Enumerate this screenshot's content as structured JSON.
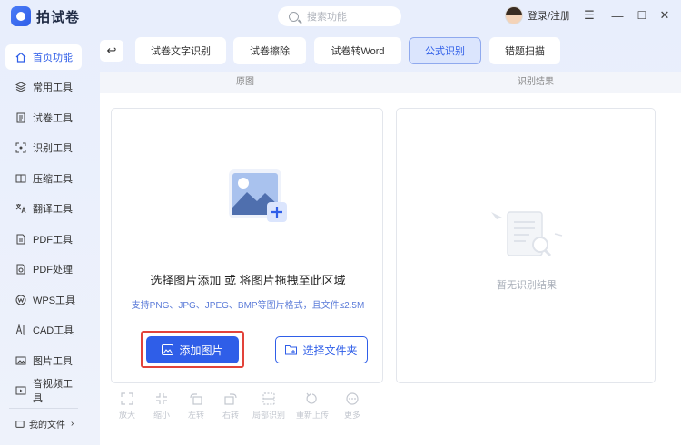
{
  "app": {
    "name": "拍试卷"
  },
  "search": {
    "placeholder": "搜索功能"
  },
  "user": {
    "login_label": "登录/注册"
  },
  "window": {
    "menu": "☰",
    "minimize": "—",
    "maximize": "☐",
    "close": "✕"
  },
  "sidebar": {
    "items": [
      {
        "label": "首页功能",
        "icon": "home-icon"
      },
      {
        "label": "常用工具",
        "icon": "layers-icon"
      },
      {
        "label": "试卷工具",
        "icon": "exam-icon"
      },
      {
        "label": "识别工具",
        "icon": "scan-icon"
      },
      {
        "label": "压缩工具",
        "icon": "compress-icon"
      },
      {
        "label": "翻译工具",
        "icon": "translate-icon"
      },
      {
        "label": "PDF工具",
        "icon": "pdf-icon"
      },
      {
        "label": "PDF处理",
        "icon": "pdf-process-icon"
      },
      {
        "label": "WPS工具",
        "icon": "wps-icon"
      },
      {
        "label": "CAD工具",
        "icon": "cad-icon"
      },
      {
        "label": "图片工具",
        "icon": "image-icon"
      },
      {
        "label": "音视频工具",
        "icon": "media-icon"
      }
    ],
    "my_files": "我的文件"
  },
  "tabs": [
    {
      "label": "试卷文字识别"
    },
    {
      "label": "试卷擦除"
    },
    {
      "label": "试卷转Word"
    },
    {
      "label": "公式识别"
    },
    {
      "label": "错题扫描"
    }
  ],
  "panel": {
    "original_label": "原图",
    "result_label": "识别结果"
  },
  "upload": {
    "title": "选择图片添加 或 将图片拖拽至此区域",
    "hint": "支持PNG、JPG、JPEG、BMP等图片格式，且文件≤2.5M",
    "add_button": "添加图片",
    "folder_button": "选择文件夹"
  },
  "result": {
    "empty_text": "暂无识别结果"
  },
  "toolbar": {
    "items": [
      {
        "label": "放大",
        "icon": "zoom-in-icon"
      },
      {
        "label": "缩小",
        "icon": "zoom-out-icon"
      },
      {
        "label": "左转",
        "icon": "rotate-left-icon"
      },
      {
        "label": "右转",
        "icon": "rotate-right-icon"
      },
      {
        "label": "局部识别",
        "icon": "partial-recognize-icon"
      },
      {
        "label": "重新上传",
        "icon": "reupload-icon"
      },
      {
        "label": "更多",
        "icon": "more-icon"
      }
    ]
  },
  "colors": {
    "accent": "#2f5ee8",
    "highlight": "#e2433a"
  }
}
